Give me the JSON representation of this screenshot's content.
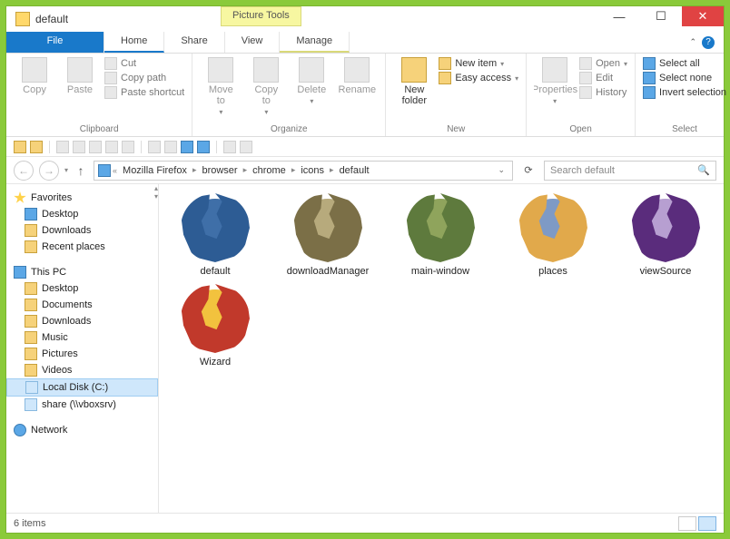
{
  "window": {
    "title": "default",
    "context_tab": "Picture Tools"
  },
  "tabs": {
    "file": "File",
    "home": "Home",
    "share": "Share",
    "view": "View",
    "manage": "Manage"
  },
  "ribbon": {
    "clipboard": {
      "label": "Clipboard",
      "copy": "Copy",
      "paste": "Paste",
      "cut": "Cut",
      "copy_path": "Copy path",
      "paste_shortcut": "Paste shortcut"
    },
    "organize": {
      "label": "Organize",
      "move_to": "Move\nto",
      "copy_to": "Copy\nto",
      "delete": "Delete",
      "rename": "Rename"
    },
    "new_grp": {
      "label": "New",
      "new_folder": "New\nfolder",
      "new_item": "New item",
      "easy_access": "Easy access"
    },
    "open_grp": {
      "label": "Open",
      "properties": "Properties",
      "open": "Open",
      "edit": "Edit",
      "history": "History"
    },
    "select": {
      "label": "Select",
      "select_all": "Select all",
      "select_none": "Select none",
      "invert": "Invert selection"
    }
  },
  "breadcrumbs": [
    "Mozilla Firefox",
    "browser",
    "chrome",
    "icons",
    "default"
  ],
  "search": {
    "placeholder": "Search default"
  },
  "sidebar": {
    "favorites": "Favorites",
    "fav_items": [
      "Desktop",
      "Downloads",
      "Recent places"
    ],
    "this_pc": "This PC",
    "pc_items": [
      "Desktop",
      "Documents",
      "Downloads",
      "Music",
      "Pictures",
      "Videos",
      "Local Disk (C:)",
      "share (\\\\vboxsrv)"
    ],
    "network": "Network"
  },
  "files": [
    {
      "name": "default",
      "globe": "#3F6FA8",
      "fox": "#2D5C94"
    },
    {
      "name": "downloadManager",
      "globe": "#B7AA7C",
      "fox": "#7B6F47"
    },
    {
      "name": "main-window",
      "globe": "#8FA45C",
      "fox": "#5E7A3D"
    },
    {
      "name": "places",
      "globe": "#7E9AC5",
      "fox": "#E1A94B"
    },
    {
      "name": "viewSource",
      "globe": "#B79FD1",
      "fox": "#5A2C7C"
    },
    {
      "name": "Wizard",
      "globe": "#F2C23E",
      "fox": "#C1392B"
    }
  ],
  "status": {
    "count": "6 items"
  }
}
